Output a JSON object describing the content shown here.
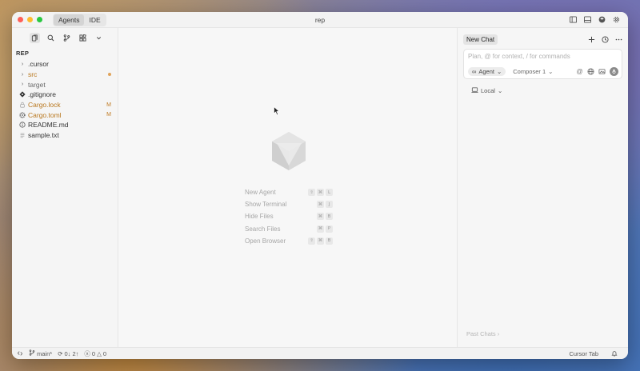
{
  "window": {
    "title": "rep",
    "modes": [
      {
        "label": "Agents",
        "active": true
      },
      {
        "label": "IDE",
        "active": false
      }
    ]
  },
  "sidebar": {
    "root_label": "REP",
    "items": [
      {
        "label": ".cursor",
        "icon": "chevron-right-icon",
        "badge": "",
        "status": "normal"
      },
      {
        "label": "src",
        "icon": "chevron-right-icon",
        "badge": "•",
        "status": "modified"
      },
      {
        "label": "target",
        "icon": "chevron-right-icon",
        "badge": "",
        "status": "dim"
      },
      {
        "label": ".gitignore",
        "icon": "git-icon",
        "badge": "",
        "status": "normal"
      },
      {
        "label": "Cargo.lock",
        "icon": "lock-file-icon",
        "badge": "M",
        "status": "modified"
      },
      {
        "label": "Cargo.toml",
        "icon": "gear-file-icon",
        "badge": "M",
        "status": "modified"
      },
      {
        "label": "README.md",
        "icon": "info-icon",
        "badge": "",
        "status": "normal"
      },
      {
        "label": "sample.txt",
        "icon": "text-file-icon",
        "badge": "",
        "status": "normal"
      }
    ]
  },
  "editor": {
    "shortcuts": [
      {
        "label": "New Agent",
        "keys": [
          "⇧",
          "⌘",
          "L"
        ]
      },
      {
        "label": "Show Terminal",
        "keys": [
          "⌘",
          "J"
        ]
      },
      {
        "label": "Hide Files",
        "keys": [
          "⌘",
          "B"
        ]
      },
      {
        "label": "Search Files",
        "keys": [
          "⌘",
          "P"
        ]
      },
      {
        "label": "Open Browser",
        "keys": [
          "⇧",
          "⌘",
          "B"
        ]
      }
    ]
  },
  "chat": {
    "tab_label": "New Chat",
    "input_placeholder": "Plan, @ for context, / for commands",
    "agent_label": "Agent",
    "model_label": "Composer 1",
    "environment_label": "Local",
    "past_chats_label": "Past Chats"
  },
  "statusbar": {
    "branch": "main*",
    "sync": "0↓ 2↑",
    "errors": "0",
    "warnings": "0",
    "cursor_tab": "Cursor Tab"
  },
  "colors": {
    "modified": "#b8761c",
    "accent_dot": "#e0a35a"
  }
}
